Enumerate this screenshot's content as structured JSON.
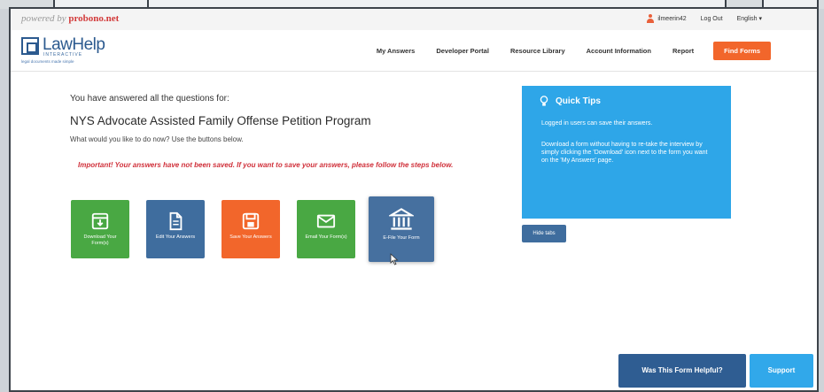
{
  "brand": {
    "powered_by_prefix": "powered by",
    "powered_by_name": "probono.net",
    "logo_text": "LawHelp",
    "logo_sub": "INTERACTIVE",
    "logo_tagline": "legal documents made simple"
  },
  "topbar": {
    "username": "ilmeerin42",
    "logout": "Log Out",
    "language": "English ▾"
  },
  "nav": {
    "links": [
      "My Answers",
      "Developer Portal",
      "Resource Library",
      "Account Information",
      "Report"
    ],
    "cta": "Find Forms"
  },
  "main": {
    "answered_text": "You have answered all the questions for:",
    "form_title": "NYS Advocate Assisted Family Offense Petition Program",
    "prompt": "What would you like to do now? Use the buttons below.",
    "warning": "Important! Your answers have not been saved. If you want to save your answers, please follow the steps below."
  },
  "actions": [
    {
      "label": "Download Your Form(s)",
      "icon": "download-icon",
      "color": "#49a843"
    },
    {
      "label": "Edit Your Answers",
      "icon": "document-icon",
      "color": "#3f6d9e"
    },
    {
      "label": "Save Your Answers",
      "icon": "save-icon",
      "color": "#f2662b"
    },
    {
      "label": "Email Your Form(s)",
      "icon": "envelope-icon",
      "color": "#49a843"
    },
    {
      "label": "E-File Your Form",
      "icon": "courthouse-icon",
      "color": "#46709f"
    }
  ],
  "tips": {
    "title": "Quick Tips",
    "p1": "Logged in users can save their answers.",
    "p2": "Download a form without having to re-take the interview by simply clicking the 'Download' icon next to the form you want on the 'My Answers' page.",
    "hide_label": "Hide tabs",
    "color": "#2ea6e8"
  },
  "footer": {
    "helpful": "Was This Form Helpful?",
    "support": "Support"
  }
}
